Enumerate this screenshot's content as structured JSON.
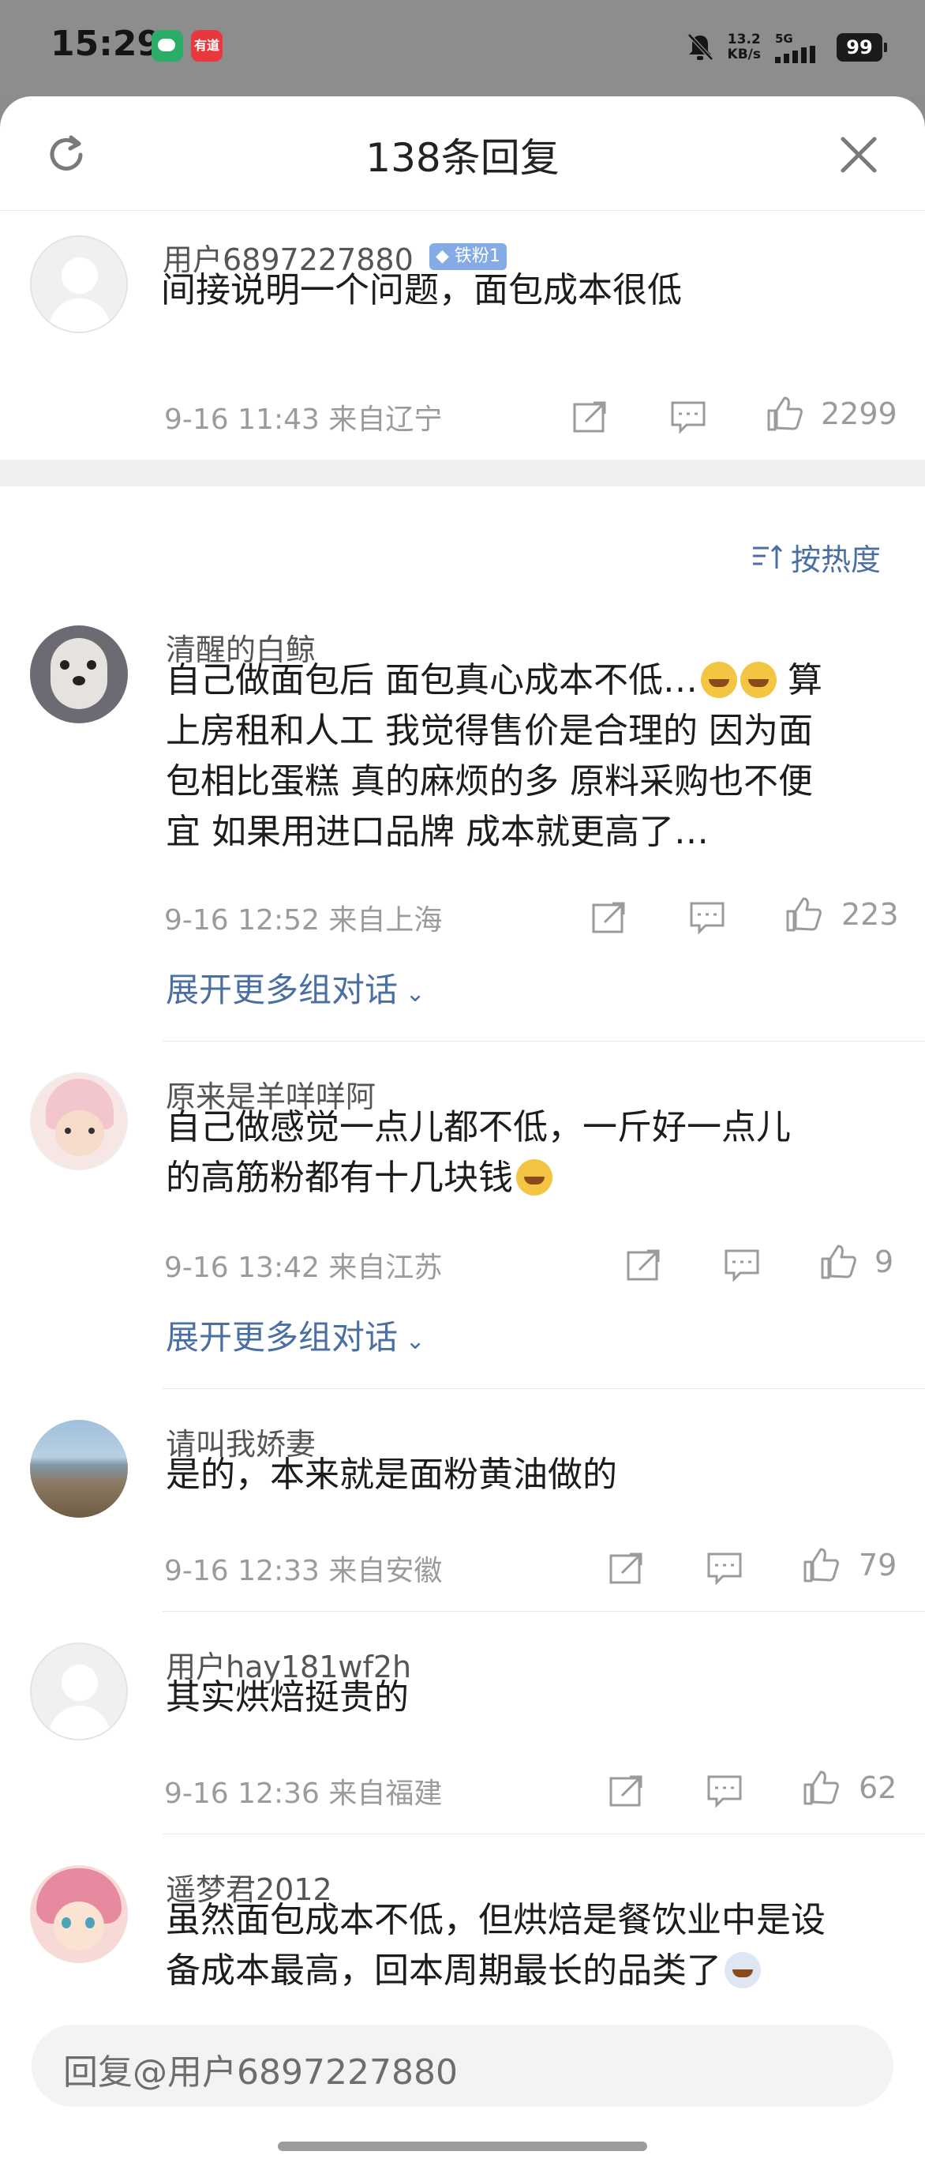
{
  "status_bar": {
    "time": "15:29",
    "net_speed": "13.2",
    "net_unit": "KB/s",
    "signal": "5G",
    "battery": "99",
    "youdao_label": "有道"
  },
  "header": {
    "title": "138条回复"
  },
  "root_comment": {
    "user": "用户6897227880",
    "badge": "铁粉1",
    "text": "间接说明一个问题，面包成本很低",
    "meta": "9-16 11:43 来自辽宁",
    "likes": "2299"
  },
  "sort_label": "按热度",
  "replies": [
    {
      "user": "清醒的白鲸",
      "text_lines": [
        "自己做面包后 面包真心成本不低…",
        "上房租和人工 我觉得售价是合理的 因为面",
        "包相比蛋糕 真的麻烦的多 原料采购也不便",
        "宜 如果用进口品牌 成本就更高了…"
      ],
      "text_tail": "算",
      "meta": "9-16 12:52 来自上海",
      "likes": "223",
      "expand": "展开更多组对话"
    },
    {
      "user": "原来是羊咩咩阿",
      "text_lines": [
        "自己做感觉一点儿都不低，一斤好一点儿",
        "的高筋粉都有十几块钱"
      ],
      "meta": "9-16 13:42 来自江苏",
      "likes": "9",
      "expand": "展开更多组对话"
    },
    {
      "user": "请叫我娇妻",
      "text_lines": [
        "是的，本来就是面粉黄油做的"
      ],
      "meta": "9-16 12:33 来自安徽",
      "likes": "79"
    },
    {
      "user": "用户hay181wf2h",
      "text_lines": [
        "其实烘焙挺贵的"
      ],
      "meta": "9-16 12:36 来自福建",
      "likes": "62"
    },
    {
      "user": "遥梦君2012",
      "text_lines": [
        "虽然面包成本不低，但烘焙是餐饮业中是设",
        "备成本最高，回本周期最长的品类了"
      ]
    }
  ],
  "reply_input": {
    "placeholder": "回复@用户6897227880"
  },
  "colors": {
    "accent_link": "#4a6fa3",
    "badge": "#85abe6",
    "meta_gray": "#9b9b9b"
  }
}
